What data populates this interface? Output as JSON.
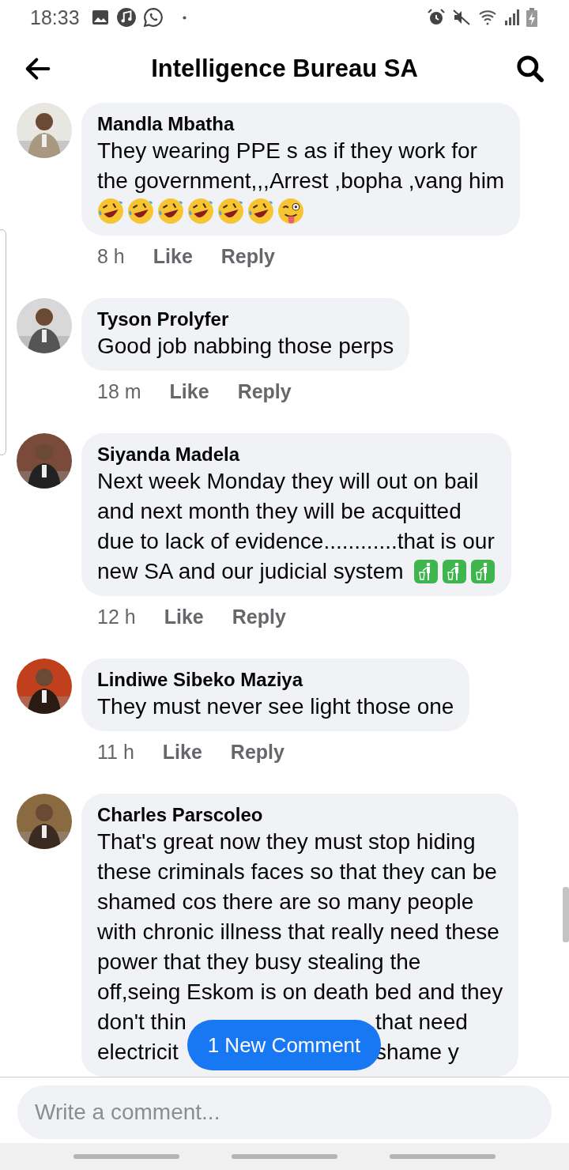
{
  "status_bar": {
    "time": "18:33"
  },
  "header": {
    "title": "Intelligence Bureau SA"
  },
  "comments": [
    {
      "author": "Mandla Mbatha",
      "lines": [
        {
          "text": "They wearing PPE s as if they work for"
        },
        {
          "text": "the government,,,Arrest ,bopha ,vang him"
        },
        {
          "emojis": [
            {
              "kind": "rofl"
            },
            {
              "kind": "rofl"
            },
            {
              "kind": "rofl"
            },
            {
              "kind": "rofl"
            },
            {
              "kind": "rofl"
            },
            {
              "kind": "rofl"
            },
            {
              "kind": "wink"
            }
          ]
        }
      ],
      "time": "8 h",
      "like": "Like",
      "reply": "Reply"
    },
    {
      "author": "Tyson Prolyfer",
      "lines": [
        {
          "text": "Good job nabbing those perps"
        }
      ],
      "time": "18 m",
      "like": "Like",
      "reply": "Reply"
    },
    {
      "author": "Siyanda Madela",
      "lines": [
        {
          "text": "Next week Monday they will out on bail"
        },
        {
          "text": "and next month they will be acquitted"
        },
        {
          "text": "due to lack of evidence............that is our"
        },
        {
          "text": "new SA and our judicial system",
          "emojis": [
            {
              "kind": "litter"
            },
            {
              "kind": "litter"
            },
            {
              "kind": "litter"
            }
          ]
        }
      ],
      "time": "12 h",
      "like": "Like",
      "reply": "Reply"
    },
    {
      "author": "Lindiwe Sibeko Maziya",
      "lines": [
        {
          "text": "They must never see light those one"
        }
      ],
      "time": "11 h",
      "like": "Like",
      "reply": "Reply"
    },
    {
      "author": "Charles Parscoleo",
      "lines": [
        {
          "text": "That's great now they must stop hiding"
        },
        {
          "text": "these criminals faces so that they can be"
        },
        {
          "text": "shamed cos there are so many people"
        },
        {
          "text": "with chronic illness that really need these"
        },
        {
          "text": "power that they busy stealing the"
        },
        {
          "text": "off,seing Eskom is on death bed and they"
        },
        {
          "segments": [
            "don't thin",
            "that need"
          ]
        },
        {
          "segments": [
            "electricit",
            "shame y"
          ]
        }
      ]
    }
  ],
  "new_comment_button": "1 New Comment",
  "composer": {
    "placeholder": "Write a comment..."
  }
}
